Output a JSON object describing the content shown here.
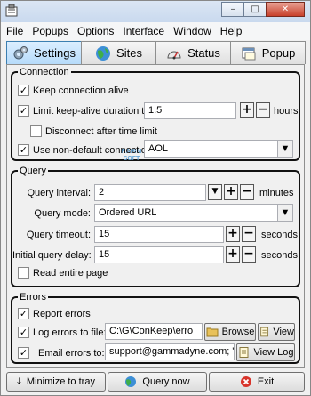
{
  "menu": [
    "File",
    "Popups",
    "Options",
    "Interface",
    "Window",
    "Help"
  ],
  "window_controls": {
    "minimize": "–",
    "maximize": "□",
    "close": "✕"
  },
  "tabs": [
    {
      "label": "Settings",
      "icon": "gears-icon",
      "active": true
    },
    {
      "label": "Sites",
      "icon": "globe-icon",
      "active": false
    },
    {
      "label": "Status",
      "icon": "gauge-icon",
      "active": false
    },
    {
      "label": "Popup",
      "icon": "popup-window-icon",
      "active": false
    }
  ],
  "watermark": {
    "line1": "RAHIM",
    "line2": "SOFT"
  },
  "connection": {
    "legend": "Connection",
    "keep_alive": {
      "label": "Keep connection alive",
      "checked": true
    },
    "limit": {
      "label": "Limit keep-alive duration to:",
      "checked": true,
      "value": "1.5",
      "unit": "hours",
      "plus": "+",
      "minus": "−"
    },
    "disconnect": {
      "label": "Disconnect after time limit",
      "checked": false
    },
    "nondefault": {
      "label": "Use non-default connection:",
      "checked": true,
      "value": "AOL"
    }
  },
  "query": {
    "legend": "Query",
    "interval": {
      "label": "Query interval:",
      "value": "2",
      "unit": "minutes"
    },
    "mode": {
      "label": "Query mode:",
      "value": "Ordered URL"
    },
    "timeout": {
      "label": "Query timeout:",
      "value": "15",
      "unit": "seconds"
    },
    "initial_delay": {
      "label": "Initial query delay:",
      "value": "15",
      "unit": "seconds"
    },
    "read_entire": {
      "label": "Read entire page",
      "checked": false
    }
  },
  "errors": {
    "legend": "Errors",
    "report": {
      "label": "Report errors",
      "checked": true
    },
    "log_file": {
      "label": "Log errors to file:",
      "checked": true,
      "value": "C:\\G\\ConKeep\\erro",
      "browse": "Browse",
      "view": "View"
    },
    "email": {
      "label": "Email errors to:",
      "checked": true,
      "value": "support@gammadyne.com; \"Gre|",
      "view_log": "View Log"
    }
  },
  "footer": {
    "minimize": "Minimize to tray",
    "query_now": "Query now",
    "exit": "Exit"
  }
}
